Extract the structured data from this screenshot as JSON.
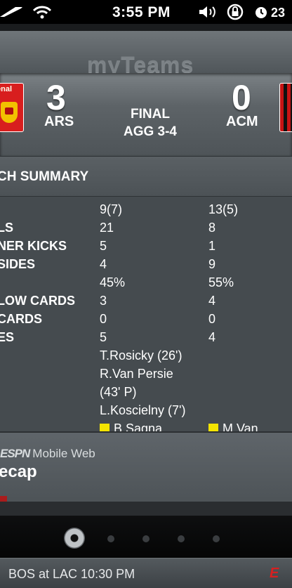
{
  "status_bar": {
    "time": "3:55 PM",
    "battery": "23"
  },
  "app": {
    "title": "myTeams"
  },
  "match": {
    "home": {
      "score": "3",
      "abbr": "ARS",
      "logo_text": "enal"
    },
    "away": {
      "score": "0",
      "abbr": "ACM"
    },
    "status": "FINAL",
    "aggregate": "AGG 3-4"
  },
  "summary": {
    "title": "CH SUMMARY",
    "rows": [
      {
        "label": "",
        "home": "9(7)",
        "away": "13(5)"
      },
      {
        "label": "LS",
        "home": "21",
        "away": "8"
      },
      {
        "label": "NER KICKS",
        "home": "5",
        "away": "1"
      },
      {
        "label": "SIDES",
        "home": "4",
        "away": "9"
      },
      {
        "label": "",
        "home": "45%",
        "away": "55%"
      },
      {
        "label": "LOW CARDS",
        "home": "3",
        "away": "4"
      },
      {
        "label": " CARDS",
        "home": "0",
        "away": "0"
      },
      {
        "label": "ES",
        "home": "5",
        "away": "4"
      },
      {
        "label": "",
        "home": "T.Rosicky (26')",
        "away": ""
      },
      {
        "label": "",
        "home": "R.Van Persie",
        "away": ""
      },
      {
        "label": "",
        "home": "(43' P)",
        "away": ""
      },
      {
        "label": "",
        "home": "L.Koscielny (7')",
        "away": ""
      },
      {
        "label": "",
        "home": "B.Sagna",
        "away": "M.Van"
      }
    ]
  },
  "promo": {
    "brand_logo": "ESPN",
    "brand_suffix": "Mobile Web",
    "title": "ecap"
  },
  "dock": {
    "page_count": 5,
    "active_page": 1
  },
  "ticker": {
    "text": "BOS at LAC 10:30 PM",
    "badge": "E"
  },
  "colors": {
    "accent_red": "#d62020",
    "card_yellow": "#f4e400"
  }
}
